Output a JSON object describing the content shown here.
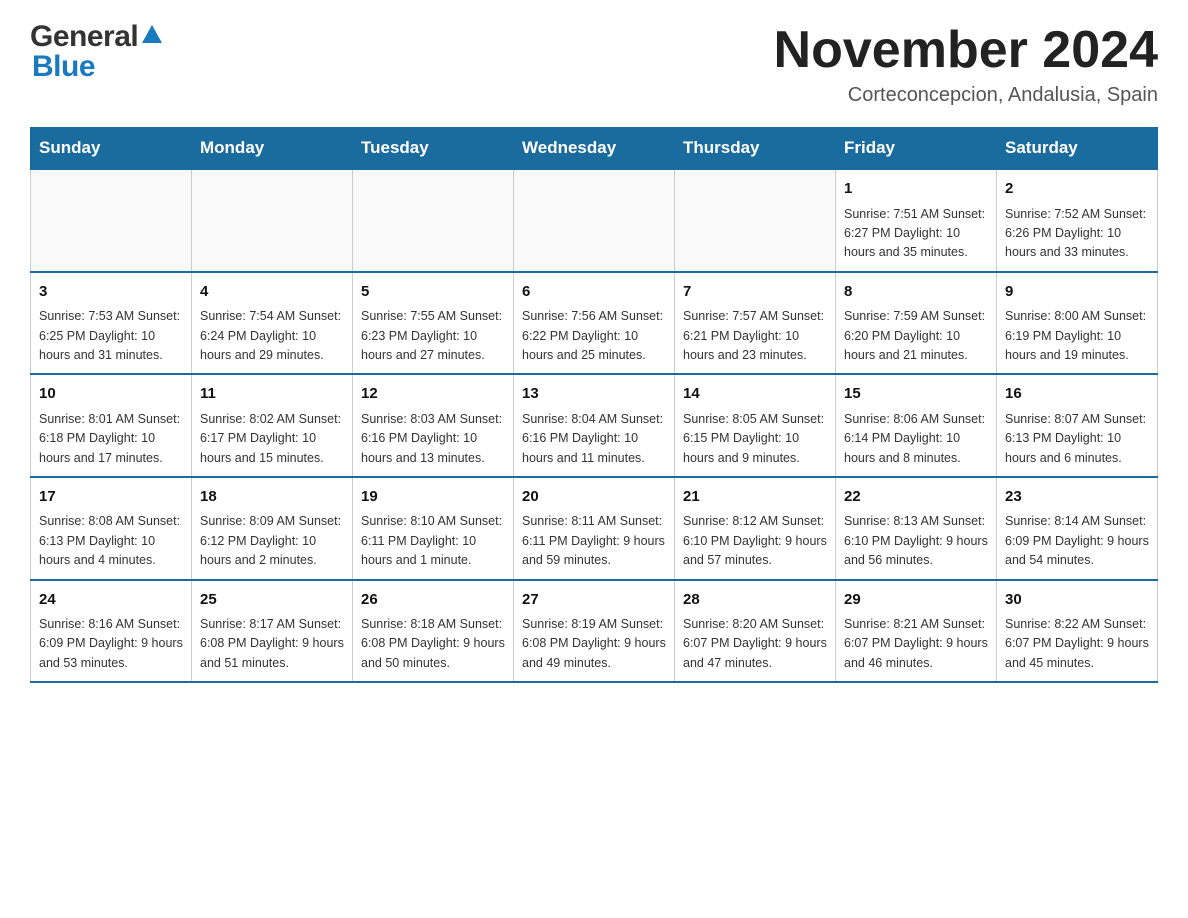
{
  "header": {
    "logo_general": "General",
    "logo_blue": "Blue",
    "main_title": "November 2024",
    "subtitle": "Corteconcepcion, Andalusia, Spain"
  },
  "calendar": {
    "days_of_week": [
      "Sunday",
      "Monday",
      "Tuesday",
      "Wednesday",
      "Thursday",
      "Friday",
      "Saturday"
    ],
    "weeks": [
      {
        "days": [
          {
            "num": "",
            "info": ""
          },
          {
            "num": "",
            "info": ""
          },
          {
            "num": "",
            "info": ""
          },
          {
            "num": "",
            "info": ""
          },
          {
            "num": "",
            "info": ""
          },
          {
            "num": "1",
            "info": "Sunrise: 7:51 AM\nSunset: 6:27 PM\nDaylight: 10 hours and 35 minutes."
          },
          {
            "num": "2",
            "info": "Sunrise: 7:52 AM\nSunset: 6:26 PM\nDaylight: 10 hours and 33 minutes."
          }
        ]
      },
      {
        "days": [
          {
            "num": "3",
            "info": "Sunrise: 7:53 AM\nSunset: 6:25 PM\nDaylight: 10 hours and 31 minutes."
          },
          {
            "num": "4",
            "info": "Sunrise: 7:54 AM\nSunset: 6:24 PM\nDaylight: 10 hours and 29 minutes."
          },
          {
            "num": "5",
            "info": "Sunrise: 7:55 AM\nSunset: 6:23 PM\nDaylight: 10 hours and 27 minutes."
          },
          {
            "num": "6",
            "info": "Sunrise: 7:56 AM\nSunset: 6:22 PM\nDaylight: 10 hours and 25 minutes."
          },
          {
            "num": "7",
            "info": "Sunrise: 7:57 AM\nSunset: 6:21 PM\nDaylight: 10 hours and 23 minutes."
          },
          {
            "num": "8",
            "info": "Sunrise: 7:59 AM\nSunset: 6:20 PM\nDaylight: 10 hours and 21 minutes."
          },
          {
            "num": "9",
            "info": "Sunrise: 8:00 AM\nSunset: 6:19 PM\nDaylight: 10 hours and 19 minutes."
          }
        ]
      },
      {
        "days": [
          {
            "num": "10",
            "info": "Sunrise: 8:01 AM\nSunset: 6:18 PM\nDaylight: 10 hours and 17 minutes."
          },
          {
            "num": "11",
            "info": "Sunrise: 8:02 AM\nSunset: 6:17 PM\nDaylight: 10 hours and 15 minutes."
          },
          {
            "num": "12",
            "info": "Sunrise: 8:03 AM\nSunset: 6:16 PM\nDaylight: 10 hours and 13 minutes."
          },
          {
            "num": "13",
            "info": "Sunrise: 8:04 AM\nSunset: 6:16 PM\nDaylight: 10 hours and 11 minutes."
          },
          {
            "num": "14",
            "info": "Sunrise: 8:05 AM\nSunset: 6:15 PM\nDaylight: 10 hours and 9 minutes."
          },
          {
            "num": "15",
            "info": "Sunrise: 8:06 AM\nSunset: 6:14 PM\nDaylight: 10 hours and 8 minutes."
          },
          {
            "num": "16",
            "info": "Sunrise: 8:07 AM\nSunset: 6:13 PM\nDaylight: 10 hours and 6 minutes."
          }
        ]
      },
      {
        "days": [
          {
            "num": "17",
            "info": "Sunrise: 8:08 AM\nSunset: 6:13 PM\nDaylight: 10 hours and 4 minutes."
          },
          {
            "num": "18",
            "info": "Sunrise: 8:09 AM\nSunset: 6:12 PM\nDaylight: 10 hours and 2 minutes."
          },
          {
            "num": "19",
            "info": "Sunrise: 8:10 AM\nSunset: 6:11 PM\nDaylight: 10 hours and 1 minute."
          },
          {
            "num": "20",
            "info": "Sunrise: 8:11 AM\nSunset: 6:11 PM\nDaylight: 9 hours and 59 minutes."
          },
          {
            "num": "21",
            "info": "Sunrise: 8:12 AM\nSunset: 6:10 PM\nDaylight: 9 hours and 57 minutes."
          },
          {
            "num": "22",
            "info": "Sunrise: 8:13 AM\nSunset: 6:10 PM\nDaylight: 9 hours and 56 minutes."
          },
          {
            "num": "23",
            "info": "Sunrise: 8:14 AM\nSunset: 6:09 PM\nDaylight: 9 hours and 54 minutes."
          }
        ]
      },
      {
        "days": [
          {
            "num": "24",
            "info": "Sunrise: 8:16 AM\nSunset: 6:09 PM\nDaylight: 9 hours and 53 minutes."
          },
          {
            "num": "25",
            "info": "Sunrise: 8:17 AM\nSunset: 6:08 PM\nDaylight: 9 hours and 51 minutes."
          },
          {
            "num": "26",
            "info": "Sunrise: 8:18 AM\nSunset: 6:08 PM\nDaylight: 9 hours and 50 minutes."
          },
          {
            "num": "27",
            "info": "Sunrise: 8:19 AM\nSunset: 6:08 PM\nDaylight: 9 hours and 49 minutes."
          },
          {
            "num": "28",
            "info": "Sunrise: 8:20 AM\nSunset: 6:07 PM\nDaylight: 9 hours and 47 minutes."
          },
          {
            "num": "29",
            "info": "Sunrise: 8:21 AM\nSunset: 6:07 PM\nDaylight: 9 hours and 46 minutes."
          },
          {
            "num": "30",
            "info": "Sunrise: 8:22 AM\nSunset: 6:07 PM\nDaylight: 9 hours and 45 minutes."
          }
        ]
      }
    ]
  }
}
